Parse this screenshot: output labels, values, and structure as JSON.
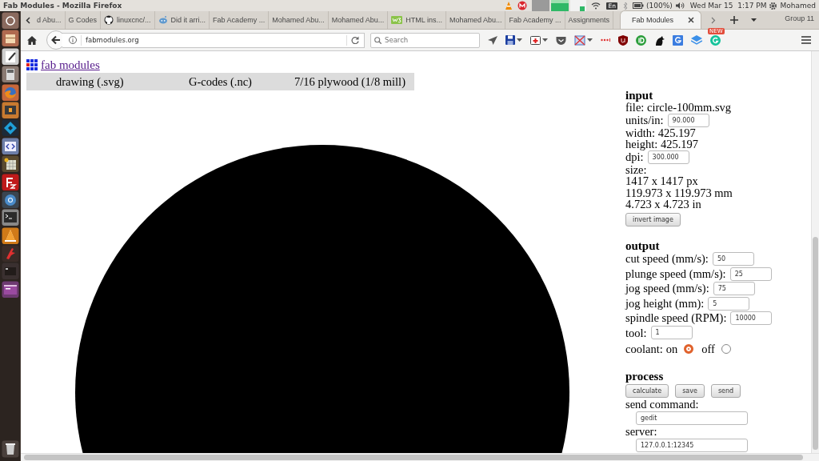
{
  "top_panel": {
    "title": "Fab Modules - Mozilla Firefox",
    "keyboard": "En",
    "battery": "(100%)",
    "clock": "Wed Mar 15  1:17 PM",
    "user": "Mohamed"
  },
  "tabs": [
    {
      "label": "d Abu...",
      "selected": false
    },
    {
      "label": "G Codes",
      "selected": false
    },
    {
      "label": "linuxcnc/...",
      "selected": false
    },
    {
      "label": "Did it arri...",
      "selected": false
    },
    {
      "label": "Fab Academy ...",
      "selected": false
    },
    {
      "label": "Mohamed Abu...",
      "selected": false
    },
    {
      "label": "Mohamed Abu...",
      "selected": false
    },
    {
      "label": "HTML ins...",
      "selected": false
    },
    {
      "label": "Mohamed Abu...",
      "selected": false
    },
    {
      "label": "Fab Academy ...",
      "selected": false
    },
    {
      "label": "Assignments",
      "selected": false
    },
    {
      "label": "Fab Modules",
      "selected": true
    }
  ],
  "tab_group": "Group 11",
  "address": {
    "url": "fabmodules.org"
  },
  "search": {
    "placeholder": "Search"
  },
  "toolbar_badge": "NEW",
  "page": {
    "logo_link": "fab modules",
    "steps": [
      "drawing (.svg)",
      "G-codes (.nc)",
      "7/16 plywood (1/8 mill)"
    ],
    "input": {
      "heading": "input",
      "file": "file: circle-100mm.svg",
      "units_label": "units/in:",
      "units": "90.000",
      "width": "width: 425.197",
      "height": "height: 425.197",
      "dpi_label": "dpi:",
      "dpi": "300.000",
      "size_lines": [
        "size:",
        "1417 x 1417 px",
        "119.973 x 119.973 mm",
        "4.723 x 4.723 in"
      ],
      "invert": "invert image"
    },
    "output": {
      "heading": "output",
      "fields": [
        {
          "label": "cut speed (mm/s):",
          "value": "50"
        },
        {
          "label": "plunge speed (mm/s):",
          "value": "25"
        },
        {
          "label": "jog speed (mm/s):",
          "value": "75"
        },
        {
          "label": "jog height (mm):",
          "value": "5"
        },
        {
          "label": "spindle speed (RPM):",
          "value": "10000"
        },
        {
          "label": "tool:",
          "value": "1"
        }
      ],
      "coolant": {
        "label": "coolant:",
        "options": [
          {
            "label": "on",
            "selected": true
          },
          {
            "label": "off",
            "selected": false
          }
        ]
      }
    },
    "process": {
      "heading": "process",
      "buttons": [
        "calculate",
        "save",
        "send"
      ],
      "fields": [
        {
          "label": "send command:",
          "value": "gedit"
        },
        {
          "label": "server:",
          "value": "127.0.0.1:12345"
        }
      ]
    }
  }
}
